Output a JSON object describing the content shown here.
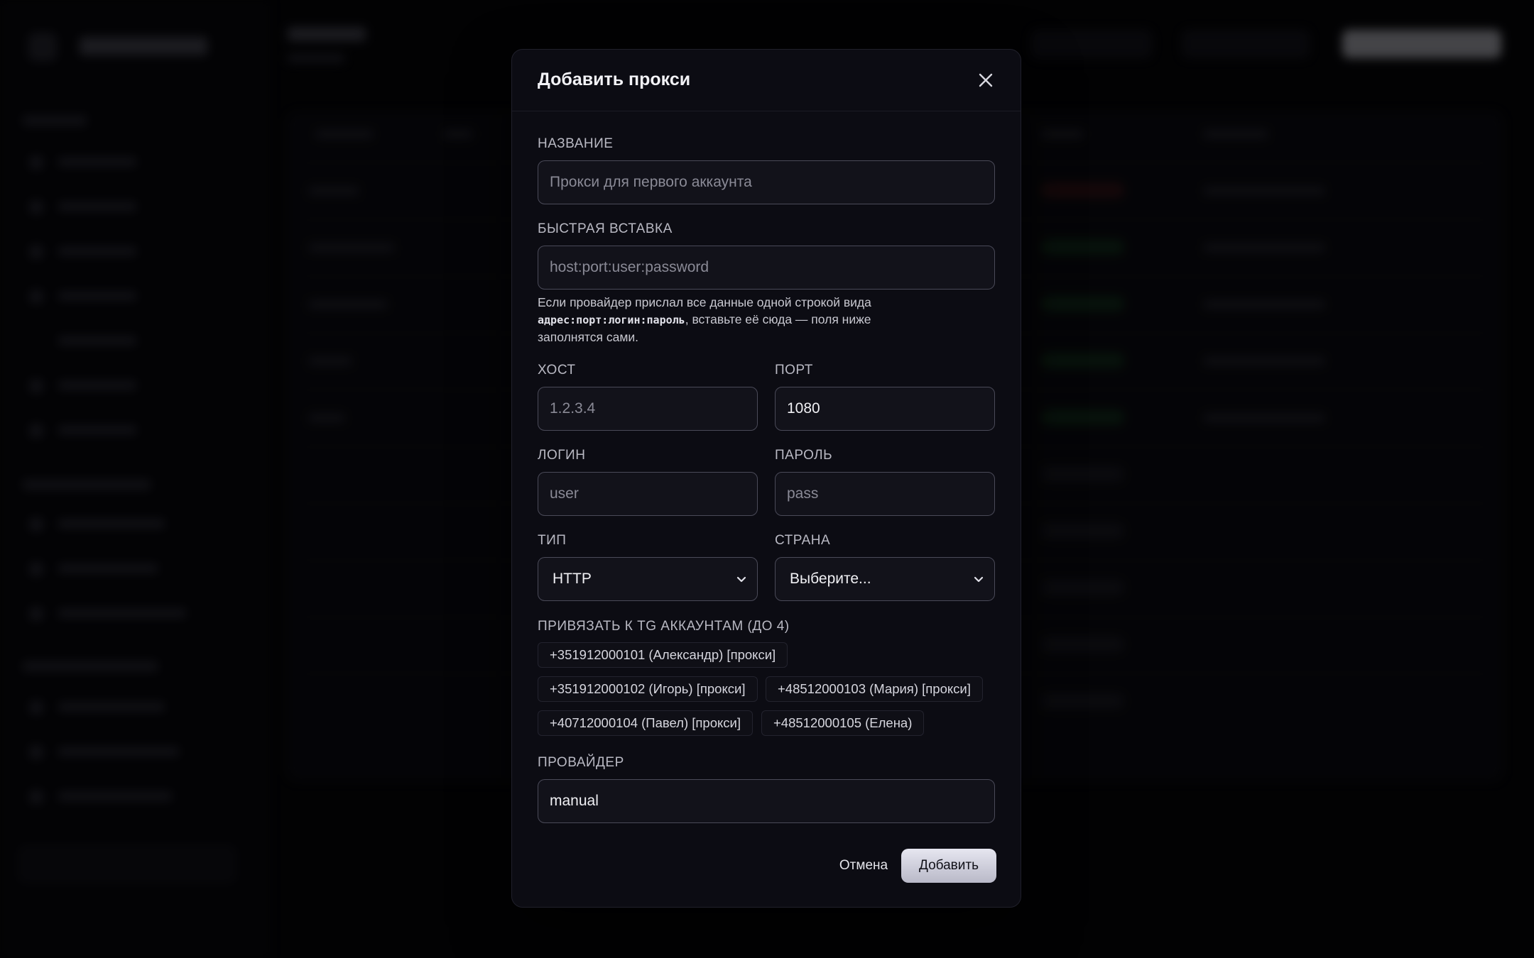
{
  "modal": {
    "title": "Добавить прокси",
    "fields": {
      "name": {
        "label": "НАЗВАНИЕ",
        "value": "",
        "placeholder": "Прокси для первого аккаунта"
      },
      "quick_paste": {
        "label": "БЫСТРАЯ ВСТАВКА",
        "value": "",
        "placeholder": "host:port:user:password",
        "hint_before": "Если провайдер прислал все данные одной строкой вида",
        "hint_code": "адрес:порт:логин:пароль",
        "hint_after": ", вставьте её сюда — поля ниже заполнятся сами."
      },
      "host": {
        "label": "ХОСТ",
        "value": "",
        "placeholder": "1.2.3.4"
      },
      "port": {
        "label": "ПОРТ",
        "value": "1080",
        "placeholder": ""
      },
      "login": {
        "label": "ЛОГИН",
        "value": "",
        "placeholder": "user"
      },
      "password": {
        "label": "ПАРОЛЬ",
        "value": "",
        "placeholder": "pass"
      },
      "type": {
        "label": "ТИП",
        "selected": "HTTP"
      },
      "country": {
        "label": "СТРАНА",
        "selected": "Выберите..."
      },
      "accounts": {
        "label": "ПРИВЯЗАТЬ К TG АККАУНТАМ (ДО 4)",
        "items": [
          "+351912000101 (Александр) [прокси]",
          "+351912000102 (Игорь) [прокси]",
          "+48512000103 (Мария) [прокси]",
          "+40712000104 (Павел) [прокси]",
          "+48512000105 (Елена)"
        ]
      },
      "provider": {
        "label": "ПРОВАЙДЕР",
        "value": "manual",
        "placeholder": ""
      }
    },
    "buttons": {
      "cancel": "Отмена",
      "submit": "Добавить"
    }
  },
  "icons": {
    "close": "close-icon",
    "select_chevron": "chevron-down-icon"
  }
}
